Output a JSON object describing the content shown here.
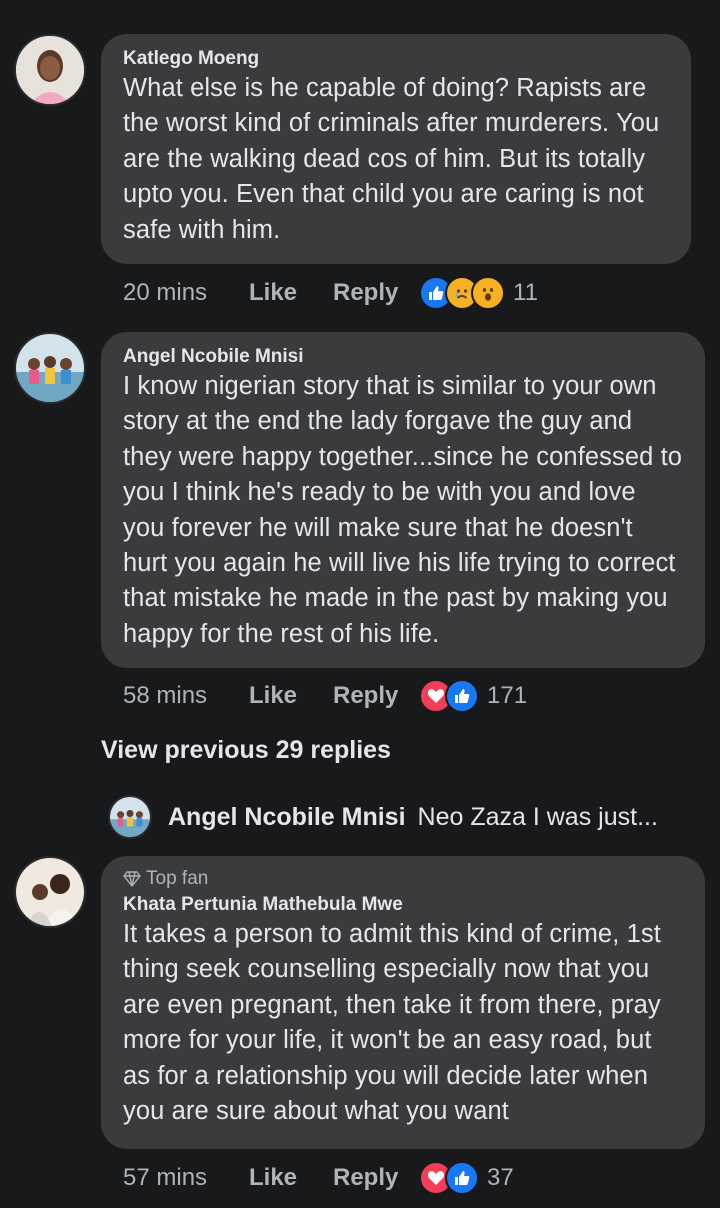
{
  "comments": [
    {
      "author": "Katlego Moeng",
      "text": "What else is he capable of doing? Rapists are the worst kind of criminals after murderers. You are the walking dead cos of him. But its totally upto you. Even that child you are caring is not safe with him.",
      "time": "20 mins",
      "like": "Like",
      "reply": "Reply",
      "reactions": [
        "like",
        "sad",
        "wow"
      ],
      "count": "11"
    },
    {
      "author": "Angel Ncobile Mnisi",
      "text": "I know nigerian story that is similar to your own story at the end the lady forgave the guy and they were happy together...since he confessed to you I think he's ready to be with you and love you forever he will make sure that he doesn't hurt you again he will live his life trying to correct that mistake he made in the past by making you happy for the rest of his life.",
      "time": "58 mins",
      "like": "Like",
      "reply": "Reply",
      "reactions": [
        "love",
        "like"
      ],
      "count": "171"
    },
    {
      "badge": "Top fan",
      "author": "Khata Pertunia Mathebula Mwe",
      "text": "It takes a person to admit this kind of crime, 1st thing seek counselling especially now that you are even pregnant, then take it from there, pray more for your life, it won't be an easy road, but as for a relationship you will decide later when you are sure about what you want",
      "time": "57 mins",
      "like": "Like",
      "reply": "Reply",
      "reactions": [
        "love",
        "like"
      ],
      "count": "37"
    }
  ],
  "view_previous": "View previous 29 replies",
  "reply_preview": {
    "author": "Angel Ncobile Mnisi",
    "snippet": "Neo Zaza  I was just..."
  },
  "colors": {
    "background": "#18191a",
    "bubble": "#3a3b3c",
    "like_blue": "#1877f2",
    "love_red": "#f33e58",
    "meta_gray": "#b0b3b8"
  }
}
